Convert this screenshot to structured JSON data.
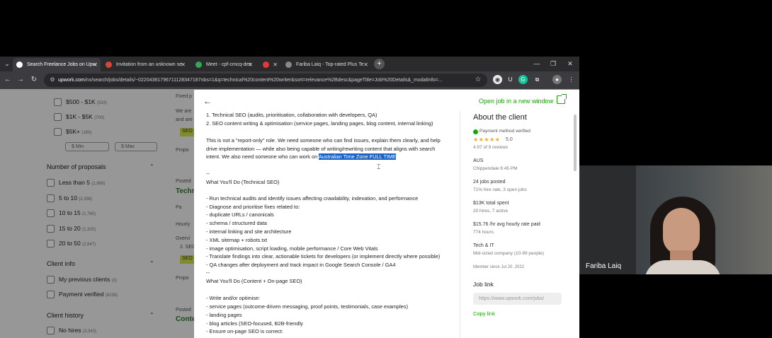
{
  "browser": {
    "tabs": [
      {
        "label": "Search Freelance Jobs on Upw",
        "active": true
      },
      {
        "label": "Invitation from an unknown se",
        "active": false
      },
      {
        "label": "Meet - cpf-cmcq-des",
        "active": false
      },
      {
        "label": "",
        "active": false
      },
      {
        "label": "Fariba Laiq - Top-rated Plus Te",
        "active": false
      }
    ],
    "url_domain": "upwork.com",
    "url_rest": "/nx/search/jobs/details/~02204381796711128347187nbs=1&q=technical%20content%20writer&sort=relevance%2Bdesc&pageTitle=Job%20Details&_modalInfo=..."
  },
  "filters": {
    "price_options": [
      {
        "label": "$500 - $1K",
        "count": "(533)"
      },
      {
        "label": "$1K - $5K",
        "count": "(700)"
      },
      {
        "label": "$5K+",
        "count": "(169)"
      }
    ],
    "min_placeholder": "$ Min",
    "max_placeholder": "$ Max",
    "proposals_heading": "Number of proposals",
    "proposals": [
      {
        "label": "Less than 5",
        "count": "(1,868)"
      },
      {
        "label": "5 to 10",
        "count": "(2,356)"
      },
      {
        "label": "10 to 15",
        "count": "(1,760)"
      },
      {
        "label": "15 to 20",
        "count": "(1,320)"
      },
      {
        "label": "20 to 50",
        "count": "(2,847)"
      }
    ],
    "client_info_heading": "Client info",
    "client_info": [
      {
        "label": "My previous clients",
        "count": "(3)"
      },
      {
        "label": "Payment verified",
        "count": "(8238)"
      }
    ],
    "client_history_heading": "Client history",
    "client_history": [
      {
        "label": "No hires",
        "count": "(3,343)"
      }
    ]
  },
  "background_snippets": {
    "fixed": "Fixed p",
    "we_are": "We are",
    "and_are": "and are",
    "seo_tag": "SEO",
    "propo": "Propo",
    "posted": "Posted",
    "techn": "Techn",
    "pa": "Pa",
    "hourly": "Hourly",
    "overv": "Overvi",
    "seo_line": "2. SEO",
    "seo_tag2": "SEO",
    "propo2": "Propo",
    "posted2": "Posted",
    "conte": "Conte"
  },
  "modal": {
    "open_job_label": "Open job in a new window",
    "job_lines": [
      "1. Technical SEO (audits, prioritisation, collaboration with developers, QA)",
      "2. SEO content writing & optimisation (service pages, landing pages, blog content, internal linking)",
      "",
      "This is not a \"report-only\" role. We need someone who can find issues, explain them clearly, and help",
      "drive implementation — while also being capable of writing/rewriting content that aligns with search",
      "",
      "",
      "--",
      "What You'll Do (Technical SEO)",
      "",
      "- Run technical audits and identify issues affecting crawlability, indexation, and performance",
      "- Diagnose and prioritise fixes related to:",
      "  - duplicate URLs / canonicals",
      "  - schema / structured data",
      "  - internal linking and site architecture",
      "  - XML sitemap + robots.txt",
      "  - image optimisation, script loading, mobile performance / Core Web Vitals",
      "- Translate findings into clear, actionable tickets for developers (or implement directly where possible)",
      "- QA changes after deployment and track impact in Google Search Console / GA4",
      "--",
      "What You'll Do (Content + On-page SEO)",
      "",
      "- Write and/or optimise:",
      "  - service pages (outcome-driven messaging, proof points, testimonials, case examples)",
      "  - landing pages",
      "  - blog articles (SEO-focused, B2B-friendly",
      "- Ensure on-page SEO is correct:"
    ],
    "intent_prefix": "intent. We also need someone who can work on ",
    "intent_highlight": "Australian Time Zone FULL TIME",
    "client": {
      "heading": "About the client",
      "payment": "Payment method verified",
      "stars": "★★★★★",
      "rating": "5.0",
      "reviews": "4.97 of 9 reviews",
      "country": "AUS",
      "city_time": "Chippendale  6:45 PM",
      "jobs_posted": "24 jobs posted",
      "jobs_sub": "71% hire rate, 3 open jobs",
      "spent": "$13K total spent",
      "spent_sub": "20 hires, 7 active",
      "rate": "$15.76 /hr avg hourly rate paid",
      "rate_sub": "774 hours",
      "industry": "Tech & IT",
      "company": "Mid-sized company (10-99 people)",
      "member_since": "Member since Jul 20, 2022"
    },
    "job_link_heading": "Job link",
    "job_link_value": "https://www.upwork.com/jobs/",
    "copy_link": "Copy link"
  },
  "webcam": {
    "name": "Fariba Laiq"
  }
}
